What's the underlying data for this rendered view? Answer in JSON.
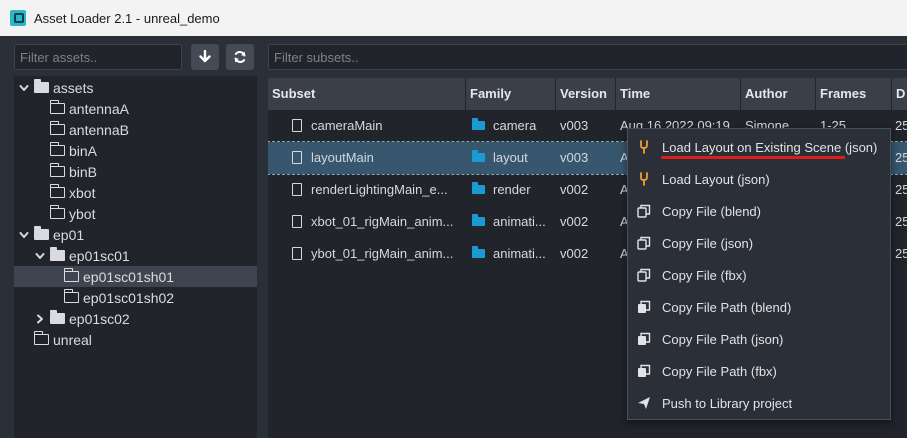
{
  "window": {
    "title": "Asset Loader 2.1 - unreal_demo"
  },
  "assets_panel": {
    "filter_placeholder": "Filter assets..",
    "tree": [
      {
        "label": "assets",
        "expanded": true,
        "level": 0,
        "has_children": true,
        "selected": false
      },
      {
        "label": "antennaA",
        "level": 1,
        "has_children": false,
        "selected": false
      },
      {
        "label": "antennaB",
        "level": 1,
        "has_children": false,
        "selected": false
      },
      {
        "label": "binA",
        "level": 1,
        "has_children": false,
        "selected": false
      },
      {
        "label": "binB",
        "level": 1,
        "has_children": false,
        "selected": false
      },
      {
        "label": "xbot",
        "level": 1,
        "has_children": false,
        "selected": false
      },
      {
        "label": "ybot",
        "level": 1,
        "has_children": false,
        "selected": false
      },
      {
        "label": "ep01",
        "expanded": true,
        "level": 0,
        "has_children": true,
        "selected": false
      },
      {
        "label": "ep01sc01",
        "expanded": true,
        "level": 1,
        "has_children": true,
        "selected": false
      },
      {
        "label": "ep01sc01sh01",
        "level": 2,
        "has_children": false,
        "selected": true
      },
      {
        "label": "ep01sc01sh02",
        "level": 2,
        "has_children": false,
        "selected": false
      },
      {
        "label": "ep01sc02",
        "expanded": false,
        "level": 1,
        "has_children": true,
        "selected": false
      },
      {
        "label": "unreal",
        "level": 0,
        "has_children": false,
        "selected": false
      }
    ],
    "download_icon": "arrow-down-icon",
    "refresh_icon": "refresh-icon"
  },
  "subsets_panel": {
    "filter_placeholder": "Filter subsets..",
    "columns": [
      "Subset",
      "Family",
      "Version",
      "Time",
      "Author",
      "Frames",
      "D"
    ],
    "rows": [
      {
        "subset": "cameraMain",
        "family": "camera",
        "version": "v003",
        "time": "Aug 16 2022 09:19",
        "author": "Simone",
        "frames": "1-25",
        "d": "25",
        "selected": false
      },
      {
        "subset": "layoutMain",
        "family": "layout",
        "version": "v003",
        "time": "A",
        "author": "",
        "frames": "",
        "d": "25",
        "selected": true
      },
      {
        "subset": "renderLightingMain_e...",
        "family": "render",
        "version": "v002",
        "time": "A",
        "author": "",
        "frames": "",
        "d": "25",
        "selected": false
      },
      {
        "subset": "xbot_01_rigMain_anim...",
        "family": "animati...",
        "version": "v002",
        "time": "A",
        "author": "",
        "frames": "",
        "d": "25",
        "selected": false
      },
      {
        "subset": "ybot_01_rigMain_anim...",
        "family": "animati...",
        "version": "v002",
        "time": "A",
        "author": "",
        "frames": "",
        "d": "25",
        "selected": false
      }
    ]
  },
  "context_menu": {
    "items": [
      {
        "label": "Load Layout on Existing Scene (json)",
        "icon": "fork-icon"
      },
      {
        "label": "Load Layout (json)",
        "icon": "fork-icon"
      },
      {
        "label": "Copy File (blend)",
        "icon": "copy-icon"
      },
      {
        "label": "Copy File (json)",
        "icon": "copy-icon"
      },
      {
        "label": "Copy File (fbx)",
        "icon": "copy-icon"
      },
      {
        "label": "Copy File Path (blend)",
        "icon": "copy-path-icon"
      },
      {
        "label": "Copy File Path (json)",
        "icon": "copy-path-icon"
      },
      {
        "label": "Copy File Path (fbx)",
        "icon": "copy-path-icon"
      },
      {
        "label": "Push to Library project",
        "icon": "send-icon"
      }
    ]
  },
  "colors": {
    "background": "#2b2f37",
    "panel": "#21252b",
    "accent_folder": "#1a9bd7",
    "selection": "#36576e",
    "loader_icon": "#f0a030",
    "annotation_underline": "#e01b1b"
  }
}
